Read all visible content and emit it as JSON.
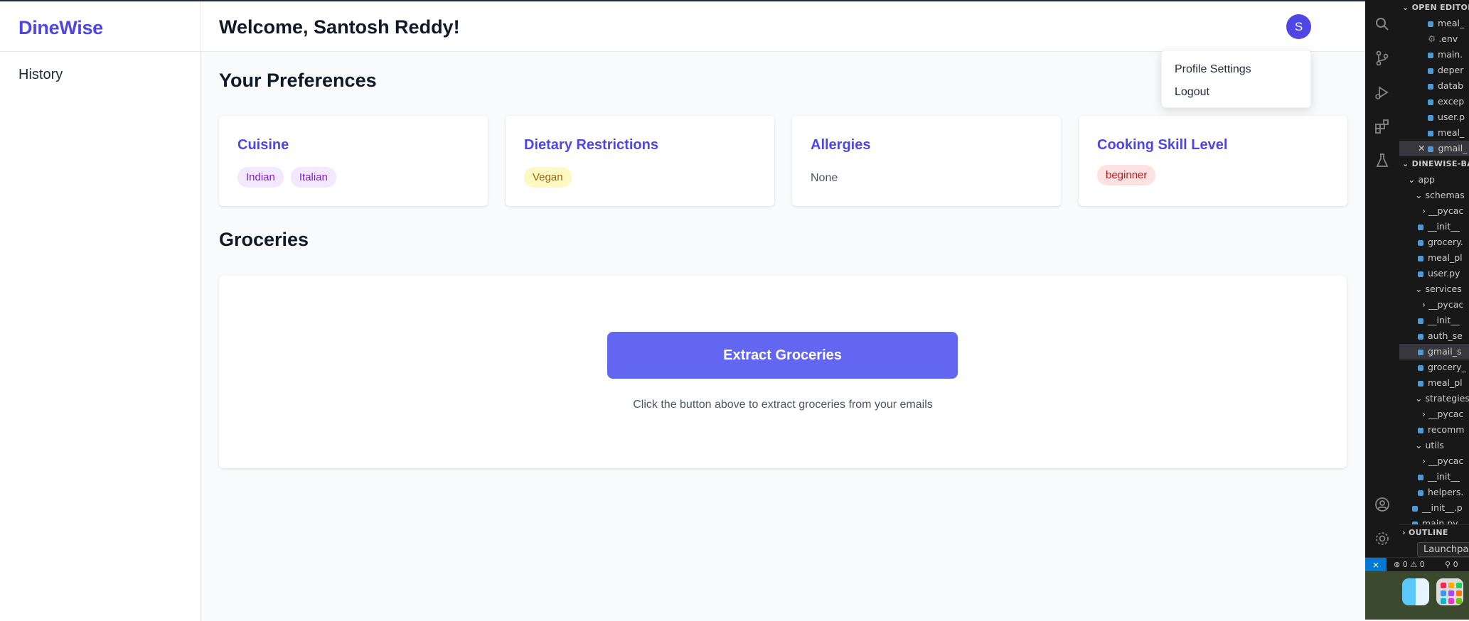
{
  "app": {
    "logo": "DineWise",
    "nav": {
      "history": "History"
    },
    "header": {
      "welcome": "Welcome, Santosh Reddy!",
      "avatar_initial": "S"
    },
    "dropdown": {
      "items": [
        "Profile Settings",
        "Logout"
      ]
    },
    "preferences": {
      "title": "Your Preferences",
      "cards": [
        {
          "title": "Cuisine",
          "tags": [
            "Indian",
            "Italian"
          ]
        },
        {
          "title": "Dietary Restrictions",
          "tags": [
            "Vegan"
          ]
        },
        {
          "title": "Allergies",
          "value": "None"
        },
        {
          "title": "Cooking Skill Level",
          "tags": [
            "beginner"
          ]
        }
      ]
    },
    "groceries": {
      "title": "Groceries",
      "button": "Extract Groceries",
      "hint": "Click the button above to extract groceries from your emails"
    }
  },
  "vscode": {
    "open_editors_header": "OPEN EDITORS",
    "open_editors": [
      "meal_",
      ".env",
      "main.",
      "deper",
      "datab",
      "excep",
      "user.p",
      "meal_",
      "gmail_"
    ],
    "project_header": "DINEWISE-BA",
    "tree": [
      "app",
      "schemas",
      "__pycac",
      "__init__",
      "grocery.",
      "meal_pl",
      "user.py",
      "services",
      "__pycac",
      "__init__",
      "auth_se",
      "gmail_s",
      "grocery_",
      "meal_pl",
      "strategies",
      "__pycac",
      "recomm",
      "utils",
      "__pycac",
      "__init__",
      "helpers.",
      "__init__.p",
      "main.py"
    ],
    "outline": "OUTLINE",
    "tooltip": "Launchpa",
    "status": {
      "errors": "0",
      "warnings": "0",
      "ports": "0"
    }
  }
}
